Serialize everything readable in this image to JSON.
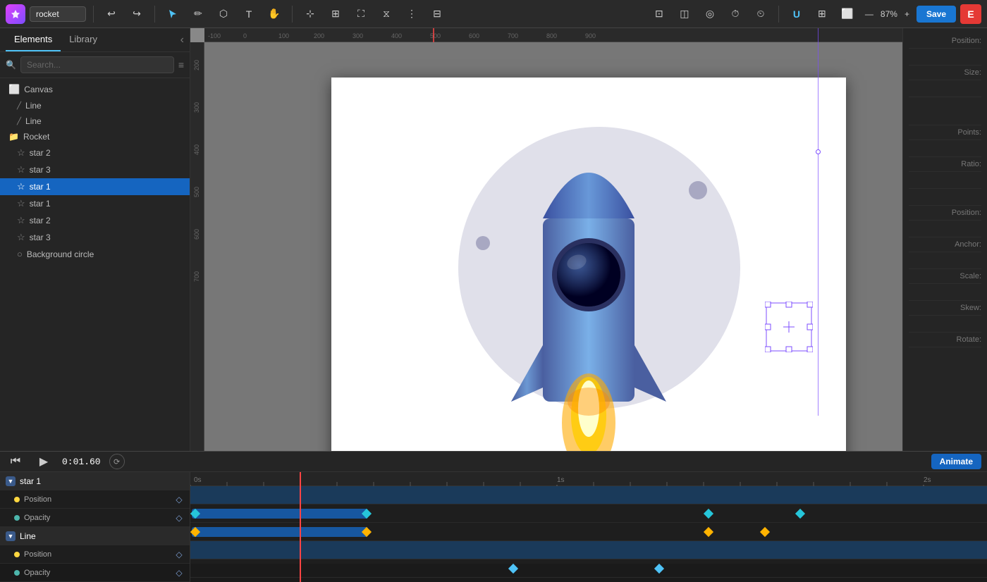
{
  "app": {
    "logo": "A",
    "project_name": "rocket",
    "save_label": "Save"
  },
  "toolbar": {
    "undo_label": "↩",
    "redo_label": "↪",
    "zoom_percent": "87%",
    "zoom_plus": "+",
    "zoom_minus": "—",
    "export_label": "E"
  },
  "panels": {
    "elements_tab": "Elements",
    "library_tab": "Library",
    "search_placeholder": "Search...",
    "collapse_icon": "‹"
  },
  "layers": [
    {
      "id": "canvas",
      "label": "Canvas",
      "type": "canvas",
      "indent": false
    },
    {
      "id": "line1",
      "label": "Line",
      "type": "line",
      "indent": true
    },
    {
      "id": "line2",
      "label": "Line",
      "type": "line",
      "indent": true
    },
    {
      "id": "rocket",
      "label": "Rocket",
      "type": "folder",
      "indent": false
    },
    {
      "id": "star2a",
      "label": "star 2",
      "type": "star",
      "indent": true
    },
    {
      "id": "star3a",
      "label": "star 3",
      "type": "star",
      "indent": true
    },
    {
      "id": "star1a",
      "label": "star 1",
      "type": "star",
      "indent": true,
      "selected": true
    },
    {
      "id": "star1b",
      "label": "star 1",
      "type": "star",
      "indent": true
    },
    {
      "id": "star2b",
      "label": "star 2",
      "type": "star",
      "indent": true
    },
    {
      "id": "star3b",
      "label": "star 3",
      "type": "star",
      "indent": true
    },
    {
      "id": "bgcircle",
      "label": "Background circle",
      "type": "circle",
      "indent": true
    }
  ],
  "right_panel": {
    "props": [
      "Position:",
      "Size:",
      "",
      "",
      "Points:",
      "Ratio:",
      "",
      "Position:",
      "Anchor:",
      "Scale:",
      "Skew:",
      "Rotate:"
    ]
  },
  "timeline": {
    "timecode": "0:01.60",
    "animate_label": "Animate",
    "tracks": [
      {
        "id": "star1",
        "label": "star 1",
        "type": "header"
      },
      {
        "id": "star1-pos",
        "label": "Position",
        "type": "prop",
        "dot": "yellow"
      },
      {
        "id": "star1-opa",
        "label": "Opacity",
        "type": "prop",
        "dot": "teal"
      },
      {
        "id": "line",
        "label": "Line",
        "type": "header"
      },
      {
        "id": "line-pos",
        "label": "Position",
        "type": "prop",
        "dot": "yellow"
      },
      {
        "id": "line-opa",
        "label": "Opacity",
        "type": "prop",
        "dot": "teal"
      }
    ],
    "ruler_marks": [
      "0s",
      "1s",
      "2s"
    ]
  }
}
